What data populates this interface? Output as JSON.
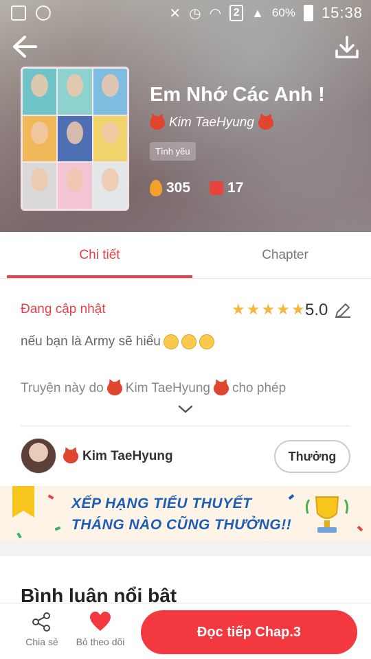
{
  "status_bar": {
    "battery_percent": "60%",
    "time": "15:38",
    "sim_slot": "2"
  },
  "book": {
    "title": "Em Nhớ Các Anh !",
    "author": "Kim TaeHyung",
    "genre": "Tình yêu",
    "stats": {
      "fire_count": "305",
      "likes_count": "17"
    }
  },
  "tabs": [
    {
      "label": "Chi tiết",
      "active": true
    },
    {
      "label": "Chapter",
      "active": false
    }
  ],
  "details": {
    "status": "Đang cập nhật",
    "rating_stars": 5,
    "rating_value": "5.0",
    "description": "nếu bạn là Army sẽ hiểu",
    "permission_prefix": "Truyện này do",
    "permission_author": "Kim TaeHyung",
    "permission_suffix": "cho phép"
  },
  "author_row": {
    "name": "Kim TaeHyung",
    "reward_label": "Thưởng"
  },
  "banner": {
    "line1": "XẾP HẠNG TIỂU THUYẾT",
    "line2": "THÁNG NÀO CŨNG THƯỞNG!!"
  },
  "comments": {
    "heading": "Bình luận nổi bật"
  },
  "bottom_bar": {
    "share_label": "Chia sẻ",
    "follow_label": "Bỏ theo dõi",
    "continue_label": "Đọc tiếp Chap.3"
  },
  "colors": {
    "accent": "#e8414a",
    "cta": "#f3383f",
    "star": "#f6b53d",
    "banner_text": "#1e5db5"
  },
  "icons": [
    "back-arrow-icon",
    "download-icon",
    "fire-icon",
    "thumbs-up-icon",
    "star-icon",
    "edit-icon",
    "chevron-down-icon",
    "share-icon",
    "heart-icon",
    "trophy-icon"
  ]
}
